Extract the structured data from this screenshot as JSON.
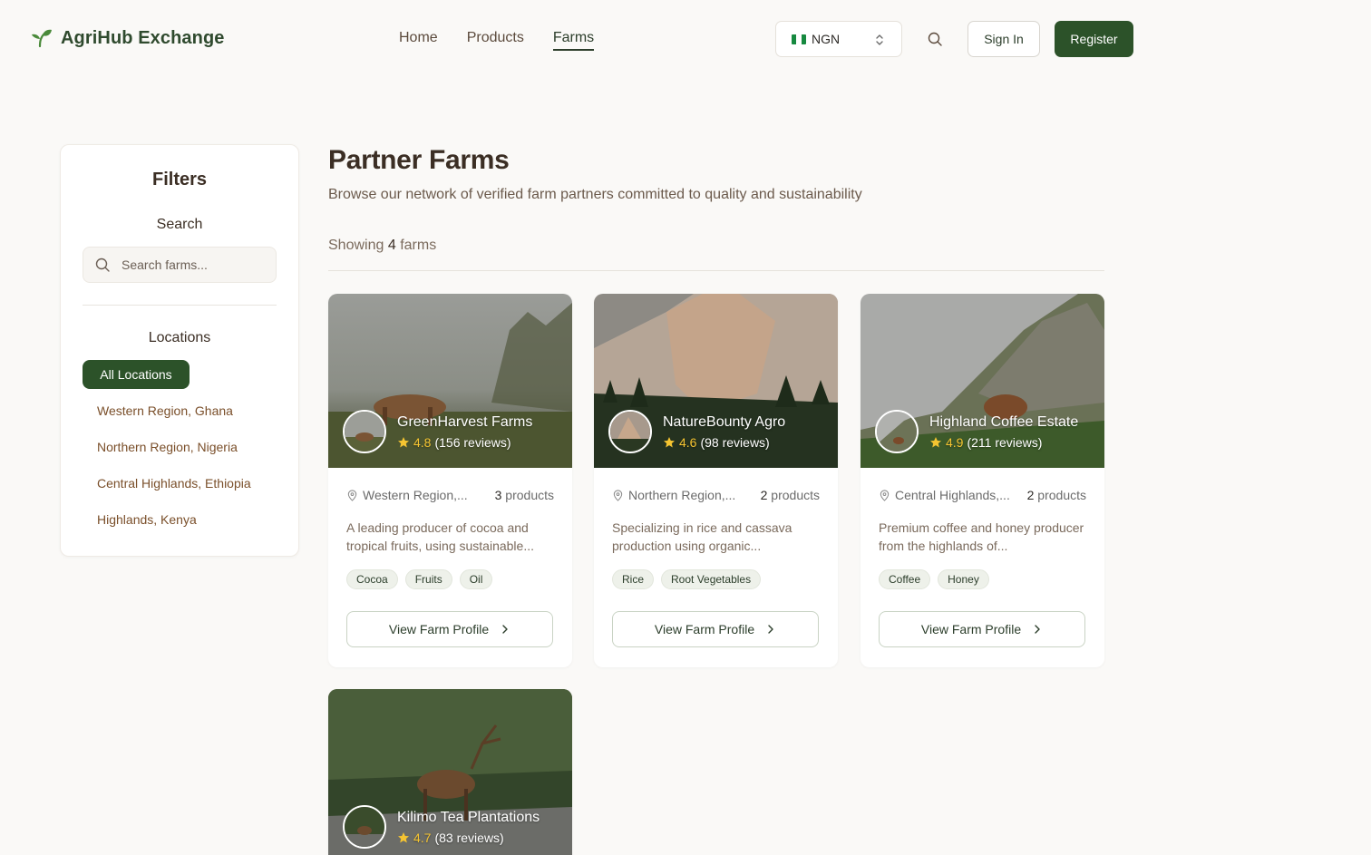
{
  "header": {
    "brand": "AgriHub Exchange",
    "nav": [
      {
        "label": "Home",
        "active": false
      },
      {
        "label": "Products",
        "active": false
      },
      {
        "label": "Farms",
        "active": true
      }
    ],
    "currency": "NGN",
    "sign_in": "Sign In",
    "register": "Register"
  },
  "sidebar": {
    "title": "Filters",
    "search_label": "Search",
    "search_placeholder": "Search farms...",
    "locations_label": "Locations",
    "locations": [
      "All Locations",
      "Western Region, Ghana",
      "Northern Region, Nigeria",
      "Central Highlands, Ethiopia",
      "Highlands, Kenya"
    ]
  },
  "main": {
    "title": "Partner Farms",
    "subtitle": "Browse our network of verified farm partners committed to quality and sustainability",
    "showing_prefix": "Showing",
    "showing_count": "4",
    "showing_suffix": "farms",
    "view_button": "View Farm Profile",
    "farms": [
      {
        "name": "GreenHarvest Farms",
        "rating": "4.8",
        "reviews": "(156 reviews)",
        "location": "Western Region,...",
        "products_count": "3",
        "products_label": "products",
        "description": "A leading producer of cocoa and tropical fruits, using sustainable...",
        "tags": [
          "Cocoa",
          "Fruits",
          "Oil"
        ]
      },
      {
        "name": "NatureBounty Agro",
        "rating": "4.6",
        "reviews": "(98 reviews)",
        "location": "Northern Region,...",
        "products_count": "2",
        "products_label": "products",
        "description": "Specializing in rice and cassava production using organic...",
        "tags": [
          "Rice",
          "Root Vegetables"
        ]
      },
      {
        "name": "Highland Coffee Estate",
        "rating": "4.9",
        "reviews": "(211 reviews)",
        "location": "Central Highlands,...",
        "products_count": "2",
        "products_label": "products",
        "description": "Premium coffee and honey producer from the highlands of...",
        "tags": [
          "Coffee",
          "Honey"
        ]
      },
      {
        "name": "Kilimo Tea Plantations",
        "rating": "4.7",
        "reviews": "(83 reviews)"
      }
    ]
  },
  "colors": {
    "brand_green": "#2c5229",
    "star": "#f5c431",
    "background": "#faf9f7",
    "location_text": "#7a4f2a"
  }
}
